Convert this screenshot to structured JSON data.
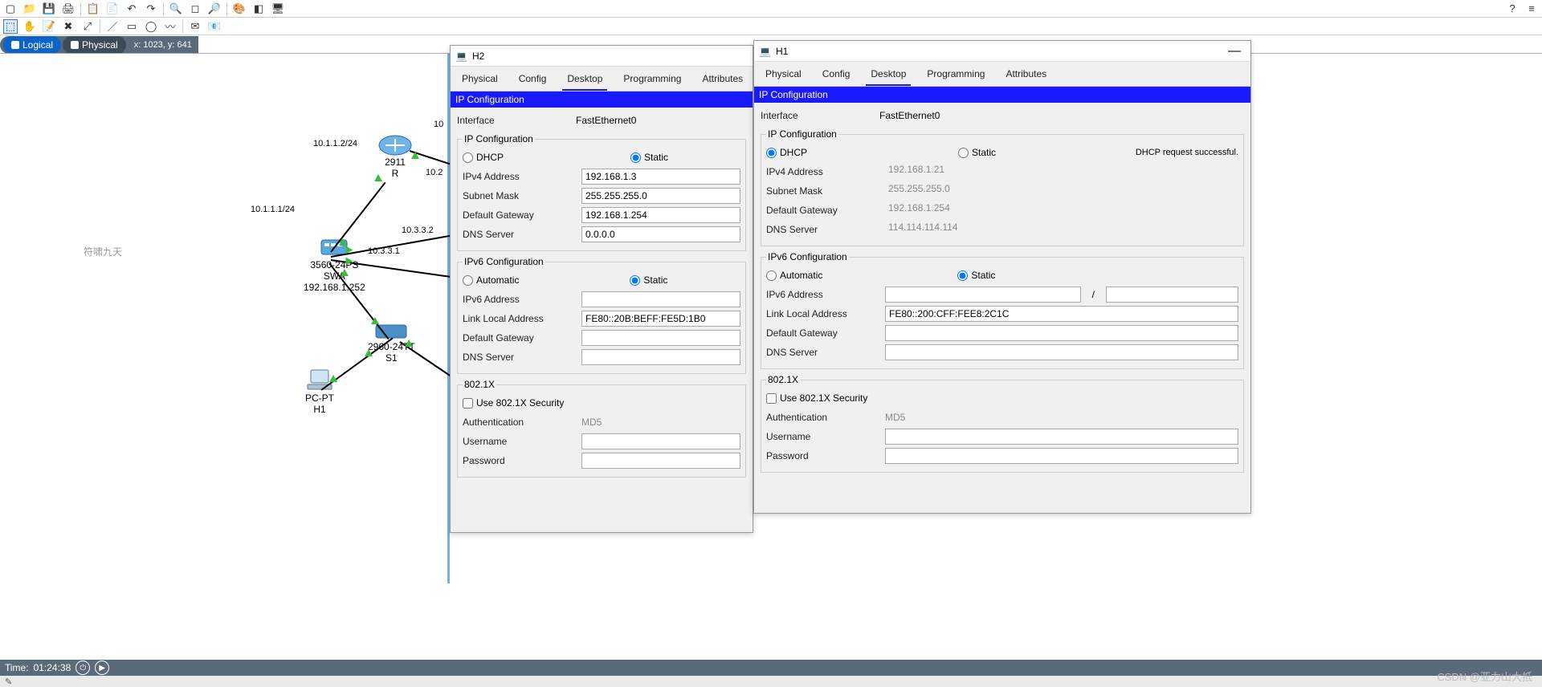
{
  "view": {
    "logical": "Logical",
    "physical": "Physical",
    "coords": "x: 1023, y: 641"
  },
  "watermarks": {
    "csdn": "CSDN @亚力山大抵",
    "center": "符啸九天"
  },
  "topology": {
    "router": {
      "model": "2911",
      "name": "R"
    },
    "l3sw": {
      "model": "3560-24PS",
      "name": "SWA",
      "ip": "192.168.1.252"
    },
    "l2sw": {
      "model": "2960-24TT",
      "name": "S1"
    },
    "pc": {
      "model": "PC-PT",
      "name": "H1"
    },
    "labels": {
      "r_left": "10.1.1.2/24",
      "swa_up": "10.1.1.1/24",
      "r_right": "10.2",
      "swa_r1": "10.3.3.2",
      "swa_r2": "10.3.3.1",
      "top_mid": "10"
    }
  },
  "timebar": {
    "label": "Time:",
    "value": "01:24:38"
  },
  "palette_colors": [
    "#000000",
    "#d00000",
    "#ff8800",
    "#ffd000",
    "#22aa22",
    "#00bcd4",
    "#0044dd",
    "#8800cc",
    "#888888",
    "#5d3a1a"
  ],
  "dlg_h2": {
    "title": "H2",
    "tabs": [
      "Physical",
      "Config",
      "Desktop",
      "Programming",
      "Attributes"
    ],
    "active_tab": "Desktop",
    "header": "IP Configuration",
    "interface_label": "Interface",
    "interface_value": "FastEthernet0",
    "ipcfg_legend": "IP Configuration",
    "dhcp": "DHCP",
    "static": "Static",
    "ip_mode": "static",
    "ipv4_label": "IPv4 Address",
    "ipv4": "192.168.1.3",
    "mask_label": "Subnet Mask",
    "mask": "255.255.255.0",
    "gw_label": "Default Gateway",
    "gw": "192.168.1.254",
    "dns_label": "DNS Server",
    "dns": "0.0.0.0",
    "ipv6_legend": "IPv6 Configuration",
    "auto": "Automatic",
    "static6": "Static",
    "ipv6_mode": "static",
    "ipv6addr_label": "IPv6 Address",
    "ipv6addr": "",
    "ll_label": "Link Local Address",
    "ll": "FE80::20B:BEFF:FE5D:1B0",
    "gw6_label": "Default Gateway",
    "gw6": "",
    "dns6_label": "DNS Server",
    "dns6": "",
    "dot1x_legend": "802.1X",
    "use1x": "Use 802.1X Security",
    "auth_label": "Authentication",
    "auth": "MD5",
    "user_label": "Username",
    "pass_label": "Password"
  },
  "dlg_h1": {
    "title": "H1",
    "tabs": [
      "Physical",
      "Config",
      "Desktop",
      "Programming",
      "Attributes"
    ],
    "active_tab": "Desktop",
    "header": "IP Configuration",
    "interface_label": "Interface",
    "interface_value": "FastEthernet0",
    "ipcfg_legend": "IP Configuration",
    "dhcp": "DHCP",
    "static": "Static",
    "ip_mode": "dhcp",
    "status": "DHCP request successful.",
    "ipv4_label": "IPv4 Address",
    "ipv4": "192.168.1.21",
    "mask_label": "Subnet Mask",
    "mask": "255.255.255.0",
    "gw_label": "Default Gateway",
    "gw": "192.168.1.254",
    "dns_label": "DNS Server",
    "dns": "114.114.114.114",
    "ipv6_legend": "IPv6 Configuration",
    "auto": "Automatic",
    "static6": "Static",
    "ipv6_mode": "static",
    "ipv6addr_label": "IPv6 Address",
    "ipv6addr": "",
    "slash": "/",
    "ll_label": "Link Local Address",
    "ll": "FE80::200:CFF:FEE8:2C1C",
    "gw6_label": "Default Gateway",
    "gw6": "",
    "dns6_label": "DNS Server",
    "dns6": "",
    "dot1x_legend": "802.1X",
    "use1x": "Use 802.1X Security",
    "auth_label": "Authentication",
    "auth": "MD5",
    "user_label": "Username",
    "pass_label": "Password"
  }
}
